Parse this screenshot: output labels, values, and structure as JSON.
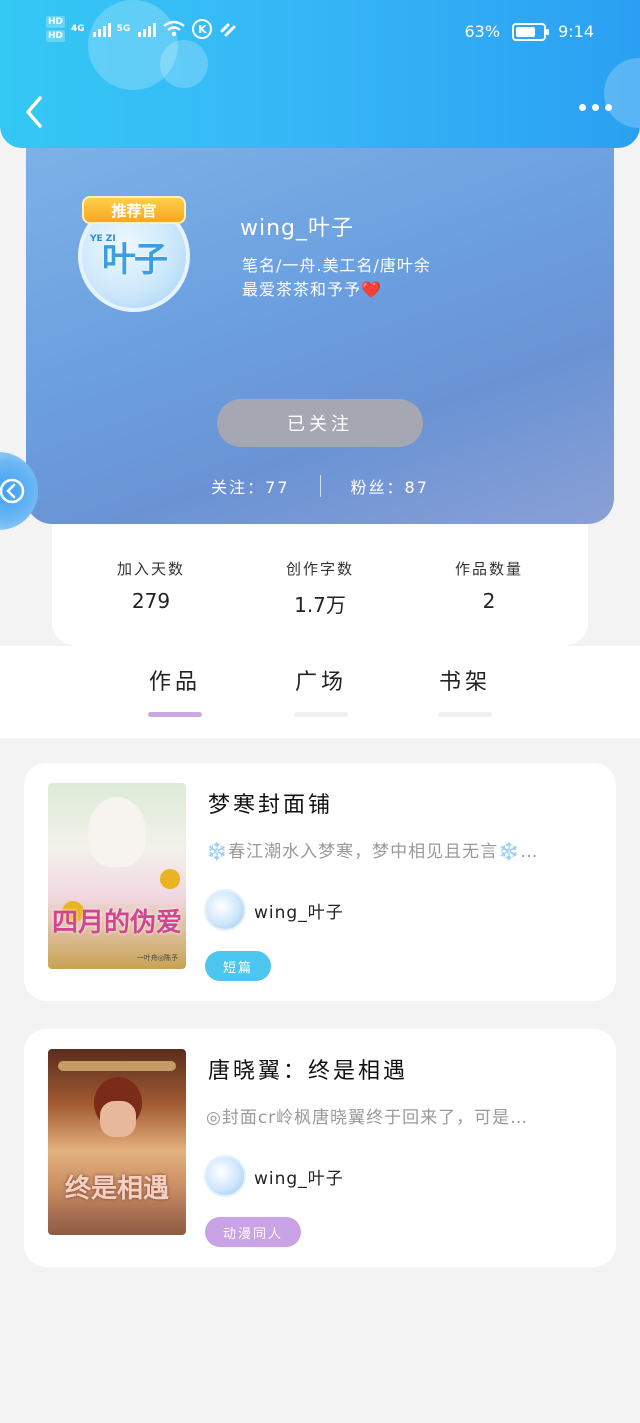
{
  "status_bar": {
    "hd1": "HD",
    "hd2": "HD",
    "net1": "4G",
    "net2": "5G",
    "k_icon": "K",
    "battery_pct": "63%",
    "time": "9:14",
    "colors": {
      "header_start": "#34c8f4",
      "header_end": "#2ba0f2"
    }
  },
  "nav": {
    "back_icon": "chevron-left-icon",
    "more_icon": "more-dots-icon"
  },
  "profile": {
    "badge": "推荐官",
    "avatar_caption": "YE ZI",
    "avatar_text": "叶子",
    "username": "wing_叶子",
    "bio_line1": "笔名/一舟.美工名/唐叶余",
    "bio_line2": "最爱茶茶和予予❤️",
    "follow_button": "已关注",
    "following_label": "关注：",
    "following_count": "77",
    "fans_label": "粉丝：",
    "fans_count": "87"
  },
  "stats": [
    {
      "label": "加入天数",
      "value": "279"
    },
    {
      "label": "创作字数",
      "value": "1.7万"
    },
    {
      "label": "作品数量",
      "value": "2"
    }
  ],
  "tabs": [
    {
      "label": "作品",
      "active": true
    },
    {
      "label": "广场",
      "active": false
    },
    {
      "label": "书架",
      "active": false
    }
  ],
  "works": [
    {
      "title": "梦寒封面铺",
      "desc": "❄️春江潮水入梦寒，梦中相见且无言❄️…",
      "author": "wing_叶子",
      "tag": "短篇",
      "tag_color": "#4cc6ef",
      "cover_text": "四月的伪爱",
      "cover_sub": "一叶舟◎陈予"
    },
    {
      "title": "唐晓翼：终是相遇",
      "desc": "◎封面cr岭枫唐晓翼终于回来了，可是…",
      "author": "wing_叶子",
      "tag": "动漫同人",
      "tag_color": "#c9a3e6",
      "cover_text": "终是相遇",
      "cover_sub": ""
    }
  ]
}
